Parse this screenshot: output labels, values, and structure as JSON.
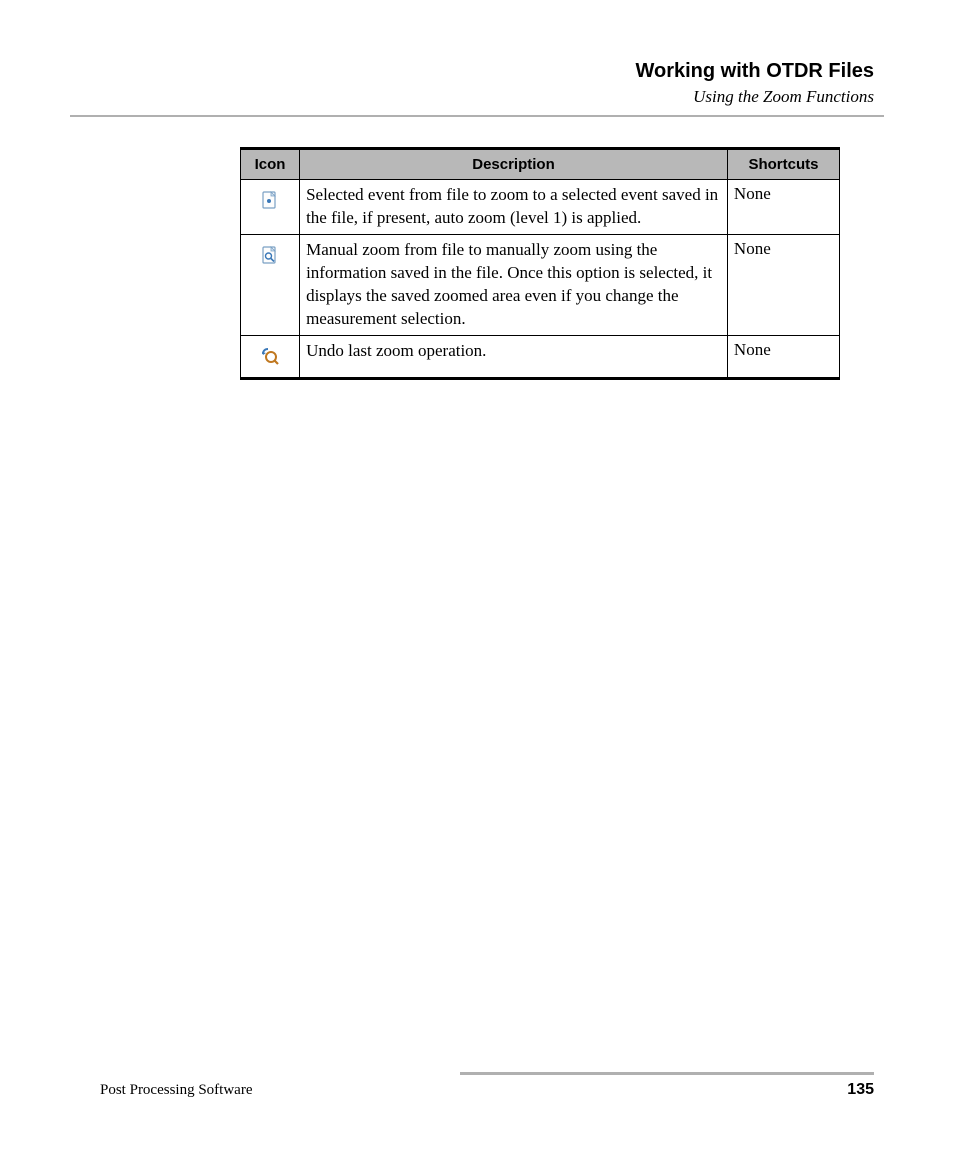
{
  "header": {
    "chapter": "Working with OTDR Files",
    "section": "Using the Zoom Functions"
  },
  "table": {
    "columns": [
      "Icon",
      "Description",
      "Shortcuts"
    ],
    "rows": [
      {
        "icon": "file-event-icon",
        "description": "Selected event from file to zoom to a selected event saved in the file, if present, auto zoom (level 1) is applied.",
        "shortcut": "None"
      },
      {
        "icon": "file-zoom-icon",
        "description": "Manual zoom from file to manually zoom using the information saved in the file. Once this option is selected, it displays the saved zoomed area even if you change the measurement selection.",
        "shortcut": "None"
      },
      {
        "icon": "undo-zoom-icon",
        "description": "Undo last zoom operation.",
        "shortcut": "None"
      }
    ]
  },
  "footer": {
    "product": "Post Processing Software",
    "page": "135"
  }
}
